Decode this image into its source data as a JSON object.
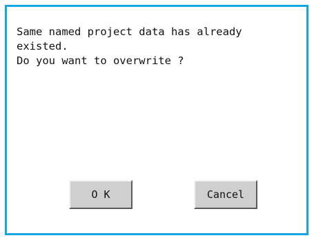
{
  "dialog": {
    "message_lines": [
      "Same named project data has already",
      "existed.",
      "Do you want to overwrite ?"
    ],
    "ok_label": "O K",
    "cancel_label": "Cancel"
  },
  "colors": {
    "border": "#14a6e0",
    "button_face": "#cfcfcf",
    "background": "#ffffff"
  }
}
